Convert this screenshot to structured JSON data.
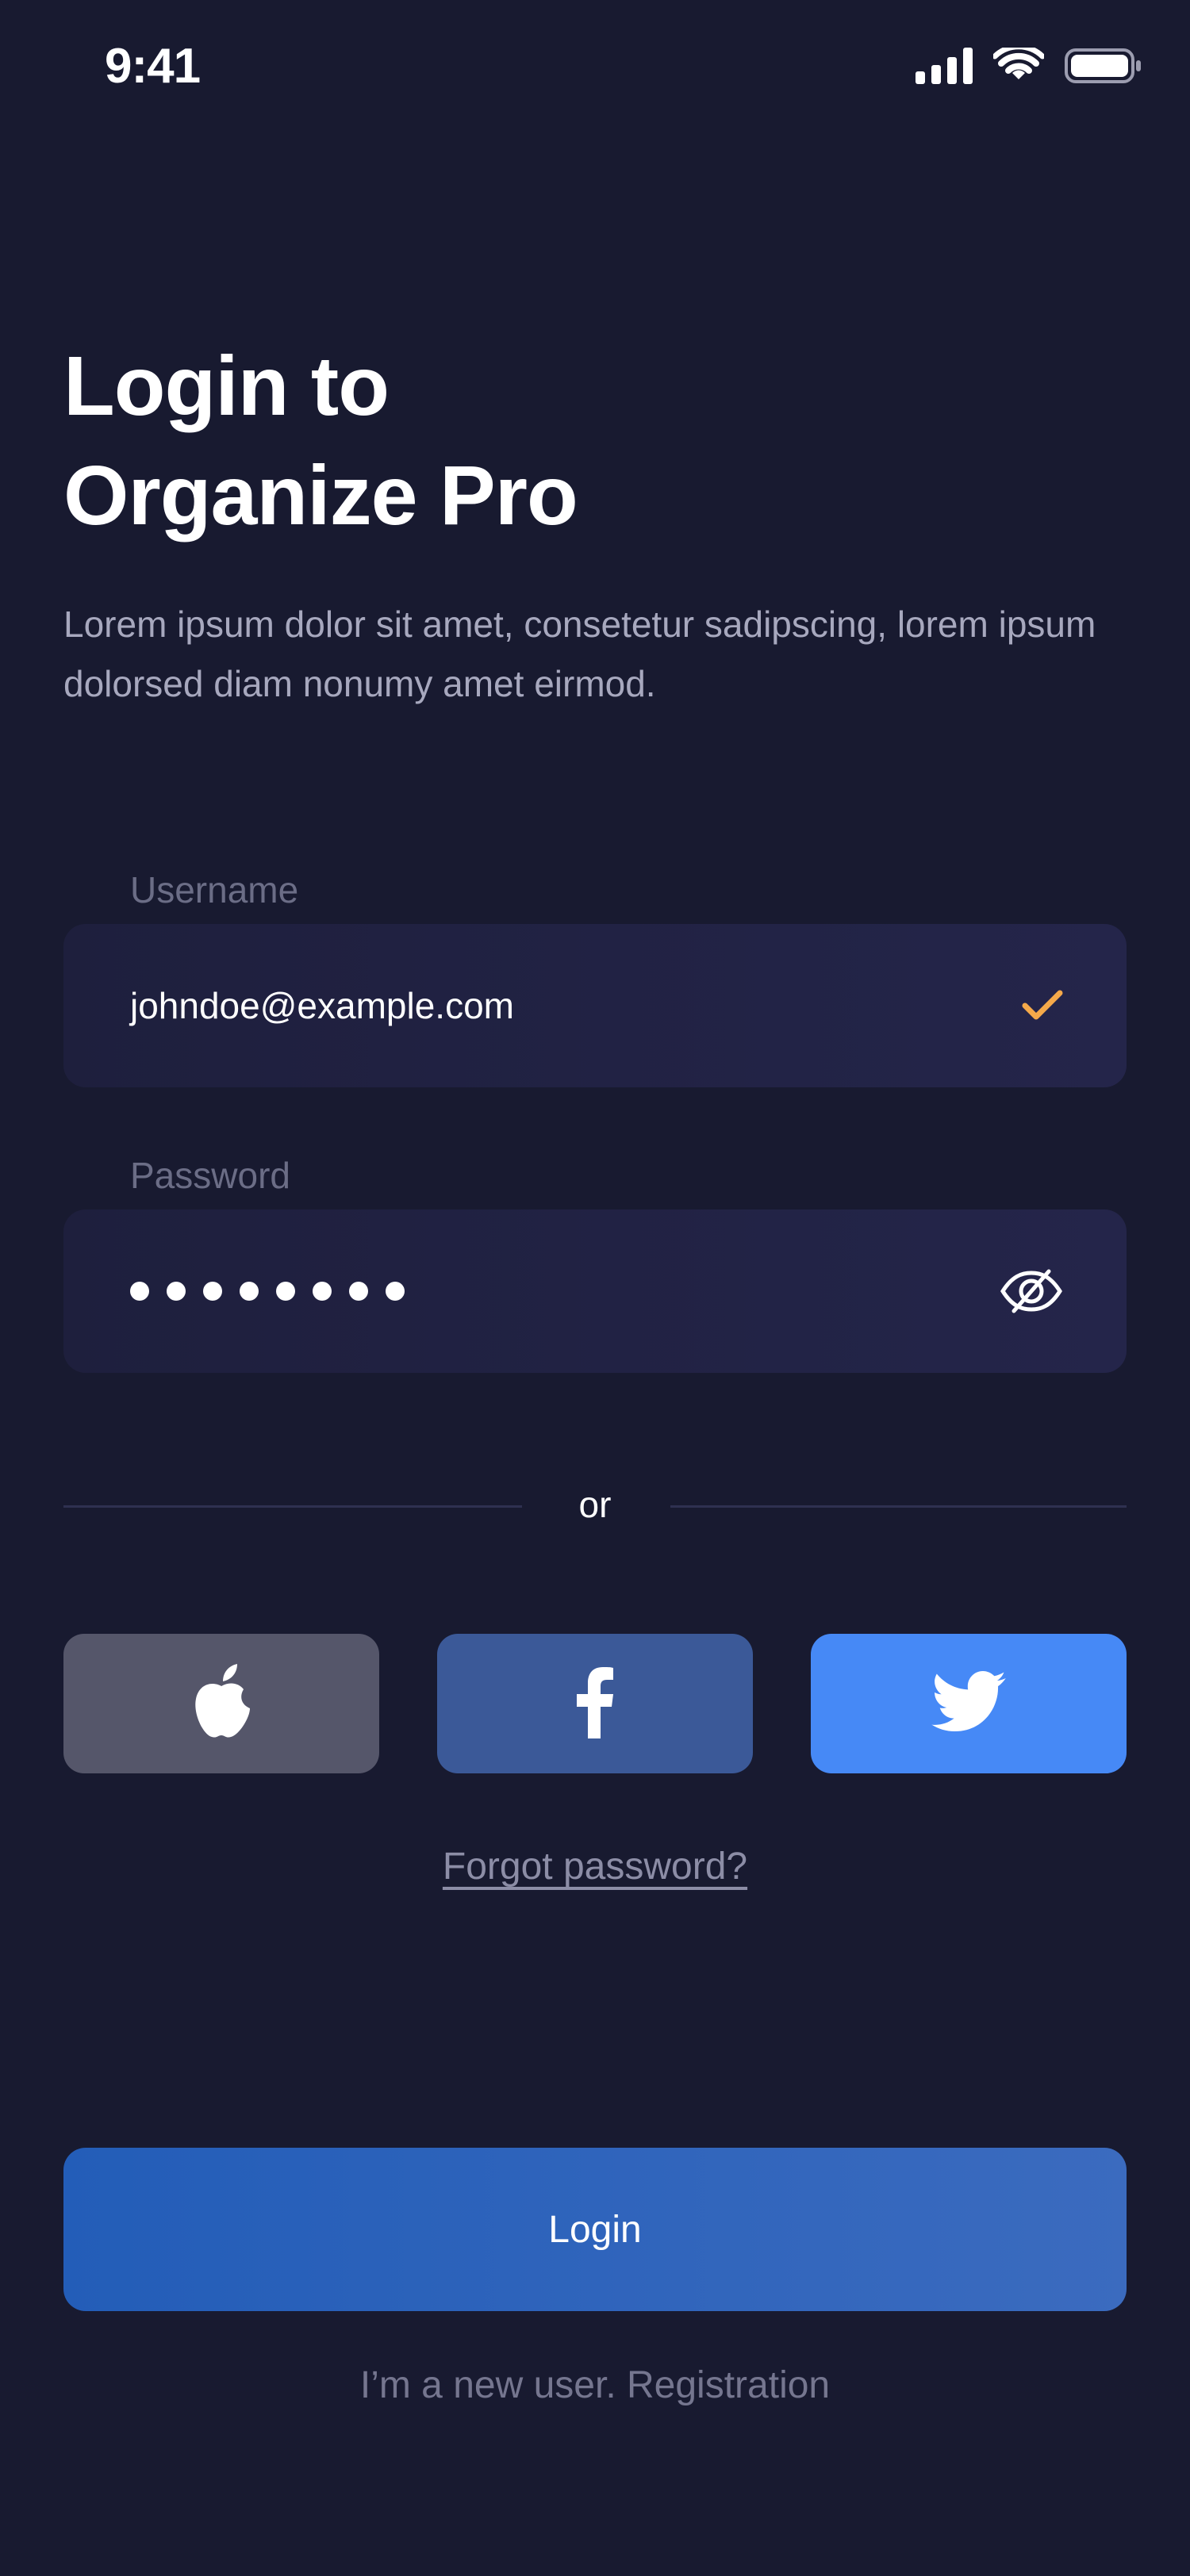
{
  "status_bar": {
    "time": "9:41"
  },
  "header": {
    "title_line1": "Login to",
    "title_line2": "Organize Pro",
    "subtitle": "Lorem ipsum dolor sit amet, consetetur sadipscing, lorem ipsum dolorsed diam nonumy amet eirmod."
  },
  "form": {
    "username": {
      "label": "Username",
      "value": "johndoe@example.com",
      "status_icon": "check-icon"
    },
    "password": {
      "label": "Password",
      "masked_length": 8,
      "toggle_icon": "eye-off-icon"
    }
  },
  "divider": {
    "text": "or"
  },
  "social": [
    {
      "name": "apple",
      "icon": "apple-icon",
      "color": "#55566a"
    },
    {
      "name": "facebook",
      "icon": "facebook-icon",
      "color": "#3b5998"
    },
    {
      "name": "twitter",
      "icon": "twitter-icon",
      "color": "#4689f6"
    }
  ],
  "links": {
    "forgot_password": "Forgot password?",
    "register": "I’m a new user. Registration"
  },
  "actions": {
    "login_label": "Login"
  },
  "colors": {
    "background": "#181a30",
    "accent_check": "#f5a94a",
    "login_button": "#2a5fb8"
  }
}
